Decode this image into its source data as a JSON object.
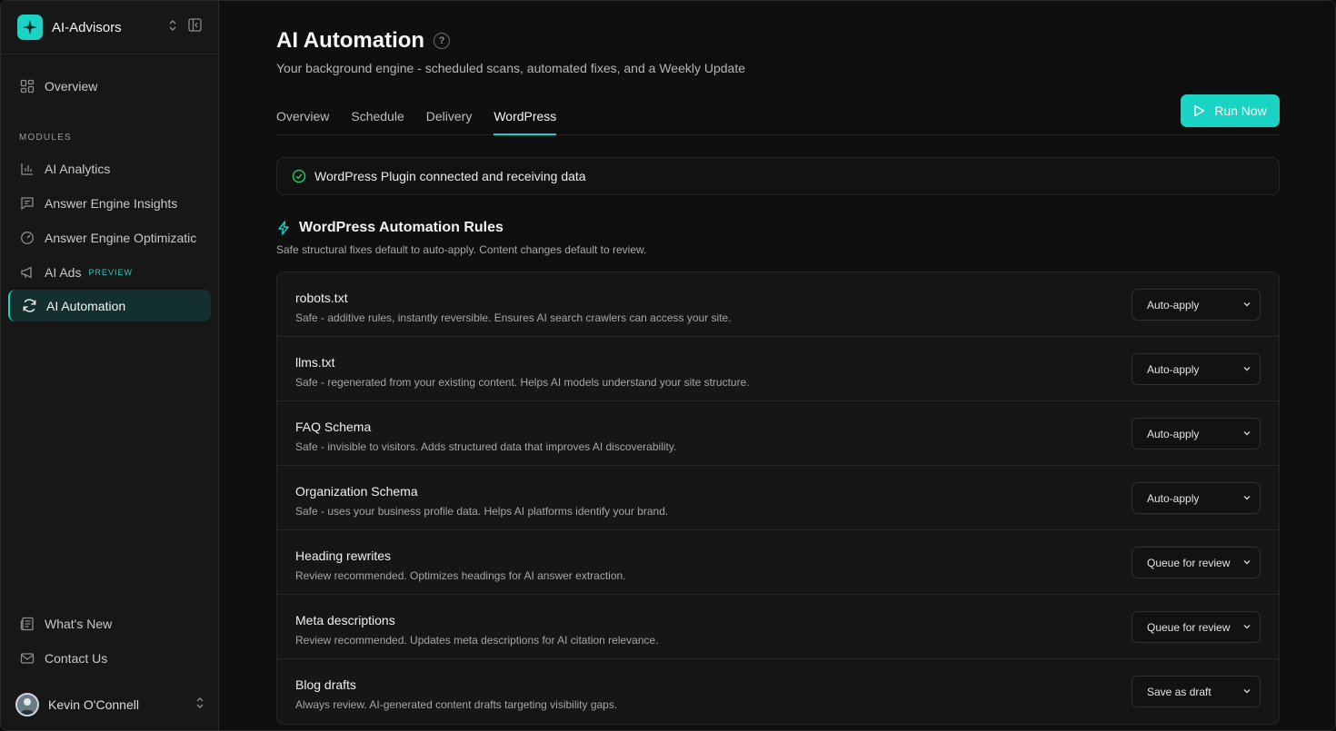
{
  "sidebar": {
    "brand": "AI-Advisors",
    "overview": "Overview",
    "section_label": "MODULES",
    "items": [
      {
        "label": "AI Analytics"
      },
      {
        "label": "Answer Engine Insights"
      },
      {
        "label": "Answer Engine Optimizatic"
      },
      {
        "label": "AI Ads",
        "badge": "PREVIEW"
      },
      {
        "label": "AI Automation"
      }
    ],
    "whats_new": "What's New",
    "contact": "Contact Us",
    "user_name": "Kevin O'Connell"
  },
  "header": {
    "title": "AI Automation",
    "help": "?",
    "subtitle": "Your background engine - scheduled scans, automated fixes, and a Weekly Update"
  },
  "tabs": [
    "Overview",
    "Schedule",
    "Delivery",
    "WordPress"
  ],
  "active_tab": "WordPress",
  "run_label": "Run Now",
  "status_text": "WordPress Plugin connected and receiving data",
  "rules_section": {
    "title": "WordPress Automation Rules",
    "subtitle": "Safe structural fixes default to auto-apply. Content changes default to review."
  },
  "rules": [
    {
      "name": "robots.txt",
      "desc": "Safe - additive rules, instantly reversible. Ensures AI search crawlers can access your site.",
      "value": "Auto-apply"
    },
    {
      "name": "llms.txt",
      "desc": "Safe - regenerated from your existing content. Helps AI models understand your site structure.",
      "value": "Auto-apply"
    },
    {
      "name": "FAQ Schema",
      "desc": "Safe - invisible to visitors. Adds structured data that improves AI discoverability.",
      "value": "Auto-apply"
    },
    {
      "name": "Organization Schema",
      "desc": "Safe - uses your business profile data. Helps AI platforms identify your brand.",
      "value": "Auto-apply"
    },
    {
      "name": "Heading rewrites",
      "desc": "Review recommended. Optimizes headings for AI answer extraction.",
      "value": "Queue for review"
    },
    {
      "name": "Meta descriptions",
      "desc": "Review recommended. Updates meta descriptions for AI citation relevance.",
      "value": "Queue for review"
    },
    {
      "name": "Blog drafts",
      "desc": "Always review. AI-generated content drafts targeting visibility gaps.",
      "value": "Save as draft"
    }
  ],
  "colors": {
    "accent": "#19d3c5",
    "success": "#22c55e",
    "active_bg": "#13302f"
  },
  "icons": [
    "sparkle-logo-icon",
    "chevrons-updown-icon",
    "sidebar-collapse-icon",
    "grid-icon",
    "bar-chart-icon",
    "message-icon",
    "gauge-icon",
    "megaphone-icon",
    "refresh-icon",
    "newspaper-icon",
    "mail-icon",
    "help-icon",
    "play-icon",
    "check-circle-icon",
    "bolt-icon",
    "chevron-down-icon"
  ]
}
